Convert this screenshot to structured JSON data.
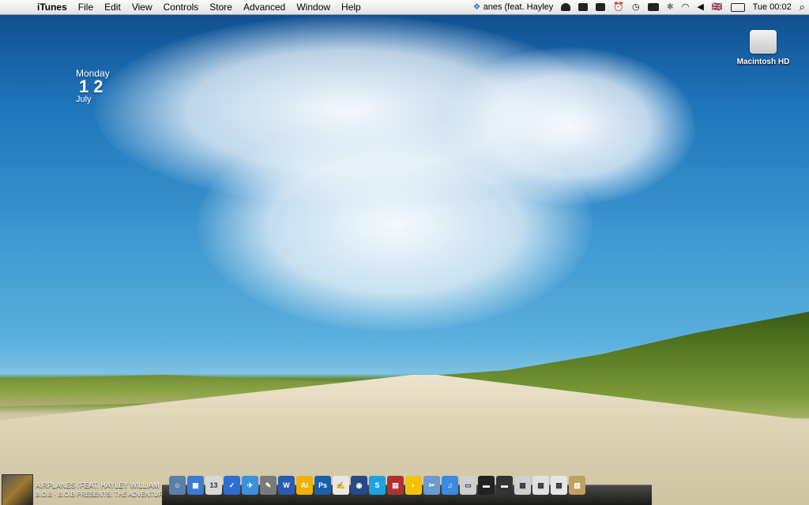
{
  "menubar": {
    "apple": "",
    "app_name": "iTunes",
    "menus": [
      "File",
      "Edit",
      "View",
      "Controls",
      "Store",
      "Advanced",
      "Window",
      "Help"
    ],
    "now_playing_ticker": "anes (feat. Hayley",
    "flag": "🇬🇧",
    "clock": "Tue 00:02",
    "search_icon": "⌕"
  },
  "date_widget": {
    "weekday": "Monday",
    "day": "12",
    "month": "July"
  },
  "desktop_icons": [
    {
      "label": "Macintosh HD",
      "icon": "hard-drive-icon"
    }
  ],
  "now_playing": {
    "title": "AIRPLANES (FEAT. HAYLEY WILLIAM",
    "subtitle": "B.O.B · B.O.B PRESENTS: THE ADVENTURE"
  },
  "dock": {
    "apps": [
      {
        "name": "finder",
        "glyph": "☺",
        "color": "#5a7fa8"
      },
      {
        "name": "preview",
        "glyph": "▣",
        "color": "#3b7bd4"
      },
      {
        "name": "ical",
        "glyph": "13",
        "color": "#d8d8d8"
      },
      {
        "name": "things",
        "glyph": "✓",
        "color": "#2c6fd1"
      },
      {
        "name": "tweetie",
        "glyph": "✈",
        "color": "#3a8fe0"
      },
      {
        "name": "app-6",
        "glyph": "✎",
        "color": "#7a7a7a"
      },
      {
        "name": "word",
        "glyph": "W",
        "color": "#2a5bb0"
      },
      {
        "name": "illustrator",
        "glyph": "Ai",
        "color": "#f0b000"
      },
      {
        "name": "photoshop",
        "glyph": "Ps",
        "color": "#1b5fa8"
      },
      {
        "name": "textedit",
        "glyph": "✍",
        "color": "#e8e8e8"
      },
      {
        "name": "safari",
        "glyph": "◉",
        "color": "#264a8a"
      },
      {
        "name": "skype",
        "glyph": "S",
        "color": "#1ca2e0"
      },
      {
        "name": "photo-booth",
        "glyph": "▤",
        "color": "#b03030"
      },
      {
        "name": "cyberduck",
        "glyph": "◐",
        "color": "#f2c300"
      },
      {
        "name": "utilities",
        "glyph": "✂",
        "color": "#6a9ad0"
      },
      {
        "name": "itunes",
        "glyph": "♫",
        "color": "#3a8ae0"
      },
      {
        "name": "folder-1",
        "glyph": "▭",
        "color": "#cfcfcf"
      },
      {
        "name": "folder-2",
        "glyph": "▬",
        "color": "#222222"
      },
      {
        "name": "folder-3",
        "glyph": "▬",
        "color": "#333333"
      },
      {
        "name": "stack-1",
        "glyph": "▦",
        "color": "#d0d0d0"
      },
      {
        "name": "stack-2",
        "glyph": "▦",
        "color": "#e0e0e0"
      },
      {
        "name": "stack-3",
        "glyph": "▦",
        "color": "#e6e6e6"
      },
      {
        "name": "trash",
        "glyph": "▥",
        "color": "#c0a060"
      }
    ]
  }
}
